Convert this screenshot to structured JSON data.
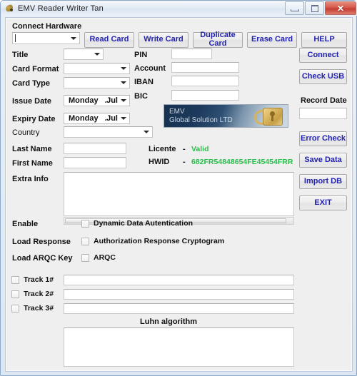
{
  "window": {
    "title": "EMV Reader Writer Tan",
    "icon": "app-leaf-icon",
    "controls": {
      "minimize": "–",
      "maximize": "□",
      "close": "✕"
    }
  },
  "toolbar": {
    "connect_hardware_label": "Connect Hardware",
    "connect_hardware_value": "",
    "buttons": [
      {
        "name": "read-card",
        "label": "Read Card"
      },
      {
        "name": "write-card",
        "label": "Write Card"
      },
      {
        "name": "duplicate-card",
        "label": "Duplicate Card"
      },
      {
        "name": "erase-card",
        "label": "Erase Card"
      },
      {
        "name": "help",
        "label": "HELP"
      }
    ]
  },
  "form": {
    "title_label": "Title",
    "title_value": "",
    "card_format_label": "Card Format",
    "card_format_value": "",
    "card_type_label": "Card Type",
    "card_type_value": "",
    "issue_date_label": "Issue Date",
    "issue_date_day": "Monday",
    "issue_date_sep": ".",
    "issue_date_month": "Jul",
    "expiry_date_label": "Expiry Date",
    "expiry_date_day": "Monday",
    "expiry_date_sep": ".",
    "expiry_date_month": "Jul",
    "country_label": "Country",
    "country_value": "",
    "last_name_label": "Last Name",
    "last_name_value": "",
    "first_name_label": "First Name",
    "first_name_value": "",
    "extra_info_label": "Extra Info",
    "extra_info_value": "",
    "pin_label": "PIN",
    "pin_value": "",
    "account_label": "Account",
    "account_value": "",
    "iban_label": "IBAN",
    "iban_value": "",
    "bic_label": "BIC",
    "bic_value": ""
  },
  "licence": {
    "licence_label": "Licente",
    "licence_dash": "-",
    "licence_value": "Valid",
    "hwid_label": "HWID",
    "hwid_dash": "-",
    "hwid_value": "682FR54848654FE45454FRR",
    "value_color": "#2bbd4c"
  },
  "logo": {
    "line1": "EMV",
    "line2": "Global Solution LTD"
  },
  "side": {
    "connect_label": "Connect",
    "check_usb_label": "Check USB",
    "record_date_label": "Record Date",
    "record_date_value": "",
    "error_check_label": "Error Check",
    "save_data_label": "Save Data",
    "import_db_label": "Import DB",
    "exit_label": "EXIT"
  },
  "options": [
    {
      "label": "Enable",
      "checkbox_label": "Dynamic Data Autentication",
      "checked": false
    },
    {
      "label": "Load Response",
      "checkbox_label": "Authorization Response Cryptogram",
      "checked": false
    },
    {
      "label": "Load ARQC Key",
      "checkbox_label": "ARQC",
      "checked": false
    }
  ],
  "tracks": [
    {
      "label": "Track 1#",
      "value": "",
      "checked": false
    },
    {
      "label": "Track 2#",
      "value": "",
      "checked": false
    },
    {
      "label": "Track 3#",
      "value": "",
      "checked": false
    }
  ],
  "luhn": {
    "title": "Luhn algorithm",
    "value": ""
  },
  "colors": {
    "button_text": "#2323b0",
    "valid_green": "#2bbd4c",
    "panel_bg": "#efefef"
  }
}
